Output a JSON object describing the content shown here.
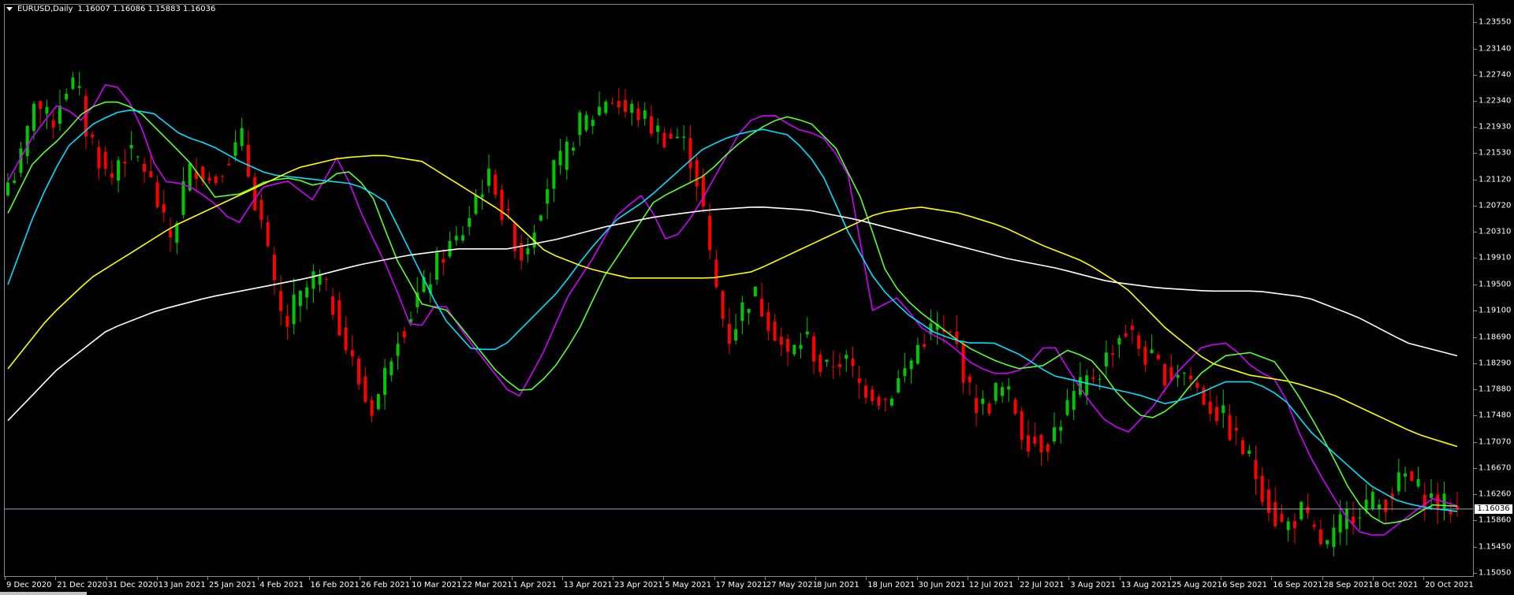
{
  "header": {
    "menu_icon": "triangle-down-icon",
    "symbol": "EURUSD,Daily",
    "ohlc": "1.16007 1.16086 1.15883 1.16036"
  },
  "current_price_label": "1.16036",
  "colors": {
    "bull": "#00c800",
    "bear": "#ff0000",
    "ma_purple": "#d000ff",
    "ma_green": "#5aff32",
    "ma_cyan": "#00e0ff",
    "ma_yellow": "#ffff00",
    "ma_white": "#ffffff",
    "bid_line": "#8fa3b8"
  },
  "chart_data": {
    "type": "candlestick",
    "symbol": "EURUSD",
    "timeframe": "Daily",
    "ylim": [
      1.1505,
      1.2395
    ],
    "y_ticks": [
      "1.23550",
      "1.23140",
      "1.22740",
      "1.22340",
      "1.21930",
      "1.21530",
      "1.21120",
      "1.20720",
      "1.20310",
      "1.19910",
      "1.19500",
      "1.19100",
      "1.18690",
      "1.18290",
      "1.17880",
      "1.17480",
      "1.17070",
      "1.16670",
      "1.16260",
      "1.15860",
      "1.15450",
      "1.15050"
    ],
    "x_ticks": [
      "9 Dec 2020",
      "21 Dec 2020",
      "31 Dec 2020",
      "13 Jan 2021",
      "25 Jan 2021",
      "4 Feb 2021",
      "16 Feb 2021",
      "26 Feb 2021",
      "10 Mar 2021",
      "22 Mar 2021",
      "1 Apr 2021",
      "13 Apr 2021",
      "23 Apr 2021",
      "5 May 2021",
      "17 May 2021",
      "27 May 2021",
      "8 Jun 2021",
      "18 Jun 2021",
      "30 Jun 2021",
      "12 Jul 2021",
      "22 Jul 2021",
      "3 Aug 2021",
      "13 Aug 2021",
      "25 Aug 2021",
      "6 Sep 2021",
      "16 Sep 2021",
      "28 Sep 2021",
      "8 Oct 2021",
      "20 Oct 2021"
    ],
    "close_anchors": [
      1.2108,
      1.2125,
      1.2165,
      1.224,
      1.2215,
      1.2195,
      1.2235,
      1.2262,
      1.2255,
      1.2188,
      1.2165,
      1.2125,
      1.2115,
      1.2155,
      1.2148,
      1.2142,
      1.2125,
      1.2085,
      1.204,
      1.2018,
      1.2095,
      1.2125,
      1.2135,
      1.211,
      1.2115,
      1.2145,
      1.2155,
      1.2175,
      1.21,
      1.206,
      1.199,
      1.192,
      1.188,
      1.192,
      1.193,
      1.196,
      1.1955,
      1.193,
      1.19,
      1.185,
      1.182,
      1.1775,
      1.176,
      1.179,
      1.184,
      1.188,
      1.189,
      1.193,
      1.1945,
      1.197,
      1.1995,
      1.201,
      1.202,
      1.205,
      1.209,
      1.211,
      1.2115,
      1.2055,
      1.204,
      1.199,
      1.202,
      1.206,
      1.21,
      1.213,
      1.214,
      1.2175,
      1.22,
      1.2205,
      1.222,
      1.224,
      1.2235,
      1.2215,
      1.222,
      1.221,
      1.2195,
      1.2185,
      1.2175,
      1.218,
      1.2165,
      1.2135,
      1.2075,
      1.198,
      1.192,
      1.1865,
      1.1895,
      1.1925,
      1.1935,
      1.191,
      1.189,
      1.186,
      1.1835,
      1.186,
      1.187,
      1.184,
      1.181,
      1.183,
      1.1835,
      1.1825,
      1.1795,
      1.179,
      1.178,
      1.177,
      1.179,
      1.181,
      1.183,
      1.186,
      1.1875,
      1.1885,
      1.1865,
      1.187,
      1.182,
      1.1775,
      1.176,
      1.1765,
      1.179,
      1.1785,
      1.176,
      1.1715,
      1.171,
      1.1705,
      1.171,
      1.1735,
      1.176,
      1.178,
      1.1795,
      1.181,
      1.182,
      1.185,
      1.187,
      1.188,
      1.186,
      1.184,
      1.183,
      1.1815,
      1.181,
      1.182,
      1.181,
      1.179,
      1.177,
      1.1755,
      1.1745,
      1.172,
      1.17,
      1.168,
      1.165,
      1.162,
      1.159,
      1.1575,
      1.1585,
      1.16,
      1.1575,
      1.1555,
      1.1545,
      1.1565,
      1.159,
      1.16,
      1.161,
      1.1615,
      1.161,
      1.162,
      1.164,
      1.1655,
      1.164,
      1.1625,
      1.162,
      1.161,
      1.1608,
      1.16036
    ],
    "series": [
      {
        "name": "ma_purple",
        "anchors": [
          1.211,
          1.218,
          1.223,
          1.22,
          1.227,
          1.222,
          1.211,
          1.2105,
          1.208,
          1.204,
          1.21,
          1.211,
          1.208,
          1.215,
          1.205,
          1.197,
          1.187,
          1.193,
          1.187,
          1.182,
          1.177,
          1.184,
          1.193,
          1.199,
          1.206,
          1.209,
          1.201,
          1.206,
          1.213,
          1.22,
          1.2215,
          1.219,
          1.218,
          1.213,
          1.191,
          1.193,
          1.188,
          1.186,
          1.1825,
          1.181,
          1.182,
          1.1865,
          1.18,
          1.1745,
          1.172,
          1.176,
          1.1815,
          1.1855,
          1.186,
          1.182,
          1.18,
          1.17,
          1.163,
          1.157,
          1.156,
          1.159,
          1.162,
          1.16086
        ]
      },
      {
        "name": "ma_green",
        "anchors": [
          1.206,
          1.214,
          1.2175,
          1.222,
          1.2235,
          1.222,
          1.218,
          1.214,
          1.2085,
          1.209,
          1.211,
          1.2115,
          1.21,
          1.213,
          1.2095,
          1.199,
          1.192,
          1.191,
          1.186,
          1.181,
          1.178,
          1.1815,
          1.1875,
          1.196,
          1.202,
          1.208,
          1.21,
          1.212,
          1.216,
          1.219,
          1.221,
          1.22,
          1.216,
          1.208,
          1.196,
          1.1915,
          1.1885,
          1.1855,
          1.1835,
          1.182,
          1.1825,
          1.185,
          1.183,
          1.1775,
          1.174,
          1.176,
          1.181,
          1.184,
          1.1845,
          1.183,
          1.177,
          1.17,
          1.162,
          1.158,
          1.1585,
          1.161,
          1.1608
        ]
      },
      {
        "name": "ma_cyan",
        "anchors": [
          1.195,
          1.207,
          1.216,
          1.22,
          1.222,
          1.2215,
          1.218,
          1.2165,
          1.214,
          1.212,
          1.2115,
          1.211,
          1.2105,
          1.208,
          1.199,
          1.19,
          1.185,
          1.185,
          1.1895,
          1.194,
          1.2,
          1.205,
          1.208,
          1.212,
          1.216,
          1.218,
          1.219,
          1.218,
          1.213,
          1.203,
          1.195,
          1.1905,
          1.1875,
          1.186,
          1.186,
          1.184,
          1.181,
          1.18,
          1.179,
          1.178,
          1.1765,
          1.178,
          1.18,
          1.18,
          1.1775,
          1.172,
          1.168,
          1.164,
          1.1615,
          1.1605,
          1.16
        ]
      },
      {
        "name": "ma_yellow",
        "anchors": [
          1.182,
          1.19,
          1.196,
          1.2,
          1.204,
          1.207,
          1.21,
          1.213,
          1.2145,
          1.215,
          1.214,
          1.21,
          1.206,
          1.2,
          1.1975,
          1.196,
          1.196,
          1.196,
          1.197,
          1.2,
          1.203,
          1.206,
          1.207,
          1.206,
          1.204,
          1.201,
          1.1985,
          1.1945,
          1.188,
          1.183,
          1.181,
          1.18,
          1.178,
          1.175,
          1.172,
          1.17
        ]
      },
      {
        "name": "ma_white",
        "anchors": [
          1.174,
          1.182,
          1.188,
          1.191,
          1.193,
          1.1945,
          1.196,
          1.198,
          1.1995,
          1.2005,
          1.2005,
          1.202,
          1.204,
          1.2055,
          1.2065,
          1.207,
          1.2065,
          1.205,
          1.203,
          1.201,
          1.199,
          1.1975,
          1.1955,
          1.1945,
          1.194,
          1.194,
          1.193,
          1.19,
          1.186,
          1.184
        ]
      }
    ]
  }
}
